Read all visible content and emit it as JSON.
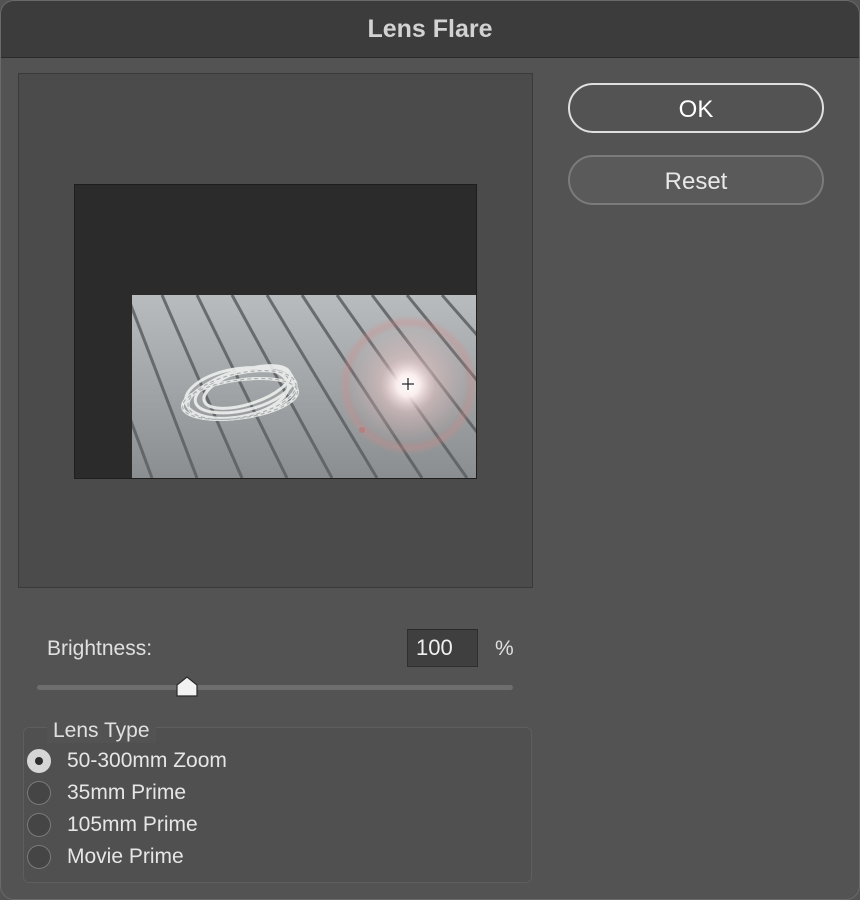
{
  "window": {
    "title": "Lens Flare"
  },
  "buttons": {
    "ok_label": "OK",
    "reset_label": "Reset"
  },
  "brightness": {
    "label": "Brightness:",
    "value": "100",
    "unit": "%",
    "slider_level": 0.31
  },
  "lens_type": {
    "legend": "Lens Type",
    "options": [
      {
        "label": "50-300mm Zoom",
        "selected": true
      },
      {
        "label": "35mm Prime",
        "selected": false
      },
      {
        "label": "105mm Prime",
        "selected": false
      },
      {
        "label": "Movie Prime",
        "selected": false
      }
    ]
  },
  "colors": {
    "dialog_background": "#535353",
    "titlebar": "#3c3c3c",
    "preview_canvas": "#2b2b2b"
  },
  "icons": {
    "flare_center": "crosshair-icon",
    "slider_thumb": "slider-thumb-icon",
    "radio_selected": "radio-selected-icon"
  }
}
